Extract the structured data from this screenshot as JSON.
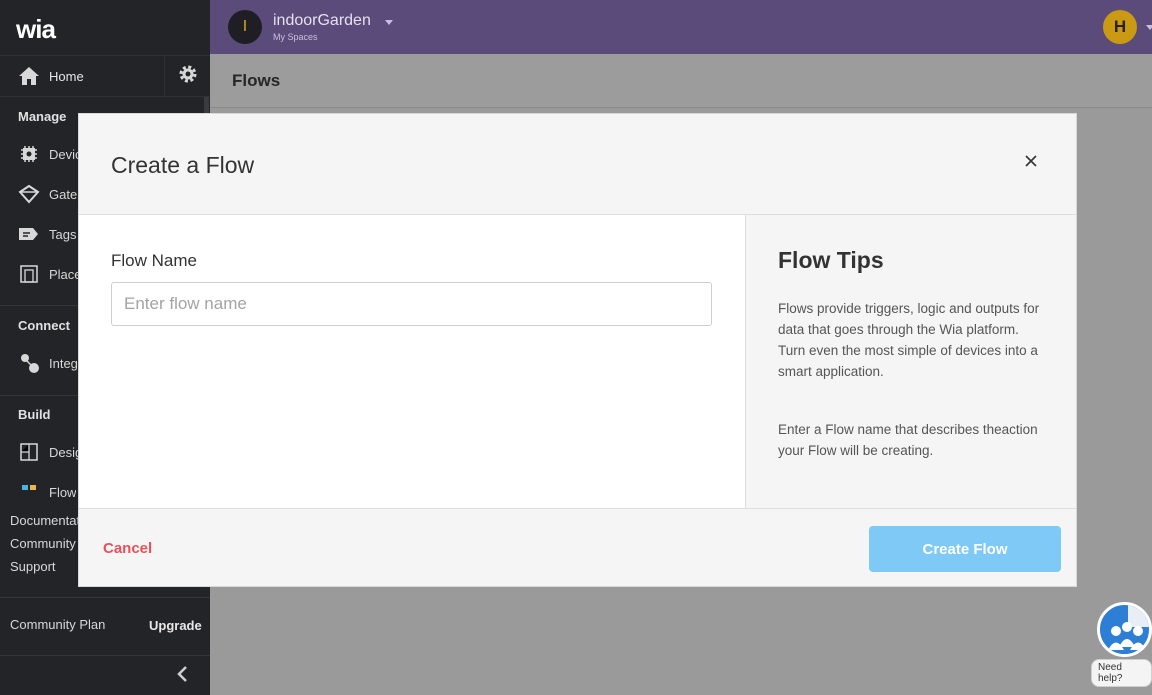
{
  "sidebar": {
    "logo": "wia",
    "home_label": "Home",
    "sections": {
      "manage": "Manage",
      "connect": "Connect",
      "build": "Build"
    },
    "items": {
      "devices": "Devic",
      "gateways": "Gate",
      "tags": "Tags",
      "places": "Place",
      "integrations": "Integ",
      "design": "Desig",
      "flows": "Flow"
    },
    "links": {
      "documentation": "Documentat",
      "community": "Community",
      "support": "Support"
    },
    "plan": "Community Plan",
    "upgrade": "Upgrade"
  },
  "topbar": {
    "space_initial": "I",
    "space_name": "indoorGarden",
    "space_sub": "My Spaces",
    "user_initial": "H"
  },
  "page": {
    "title": "Flows"
  },
  "modal": {
    "title": "Create a Flow",
    "field_label": "Flow Name",
    "field_placeholder": "Enter flow name",
    "field_value": "",
    "tips_title": "Flow Tips",
    "tips_p1": "Flows provide triggers, logic and outputs for data that goes through the Wia platform. Turn even the most simple of devices into a smart application.",
    "tips_p2": "Enter a Flow name that describes theaction your Flow will be creating.",
    "cancel_label": "Cancel",
    "create_label": "Create Flow"
  },
  "help": {
    "label": "Need help?"
  },
  "colors": {
    "sidebar_bg": "#232428",
    "topbar_bg": "#5b4b7a",
    "cancel": "#e8515b",
    "create_button": "#7ec9f5",
    "user_avatar": "#c99a12"
  }
}
